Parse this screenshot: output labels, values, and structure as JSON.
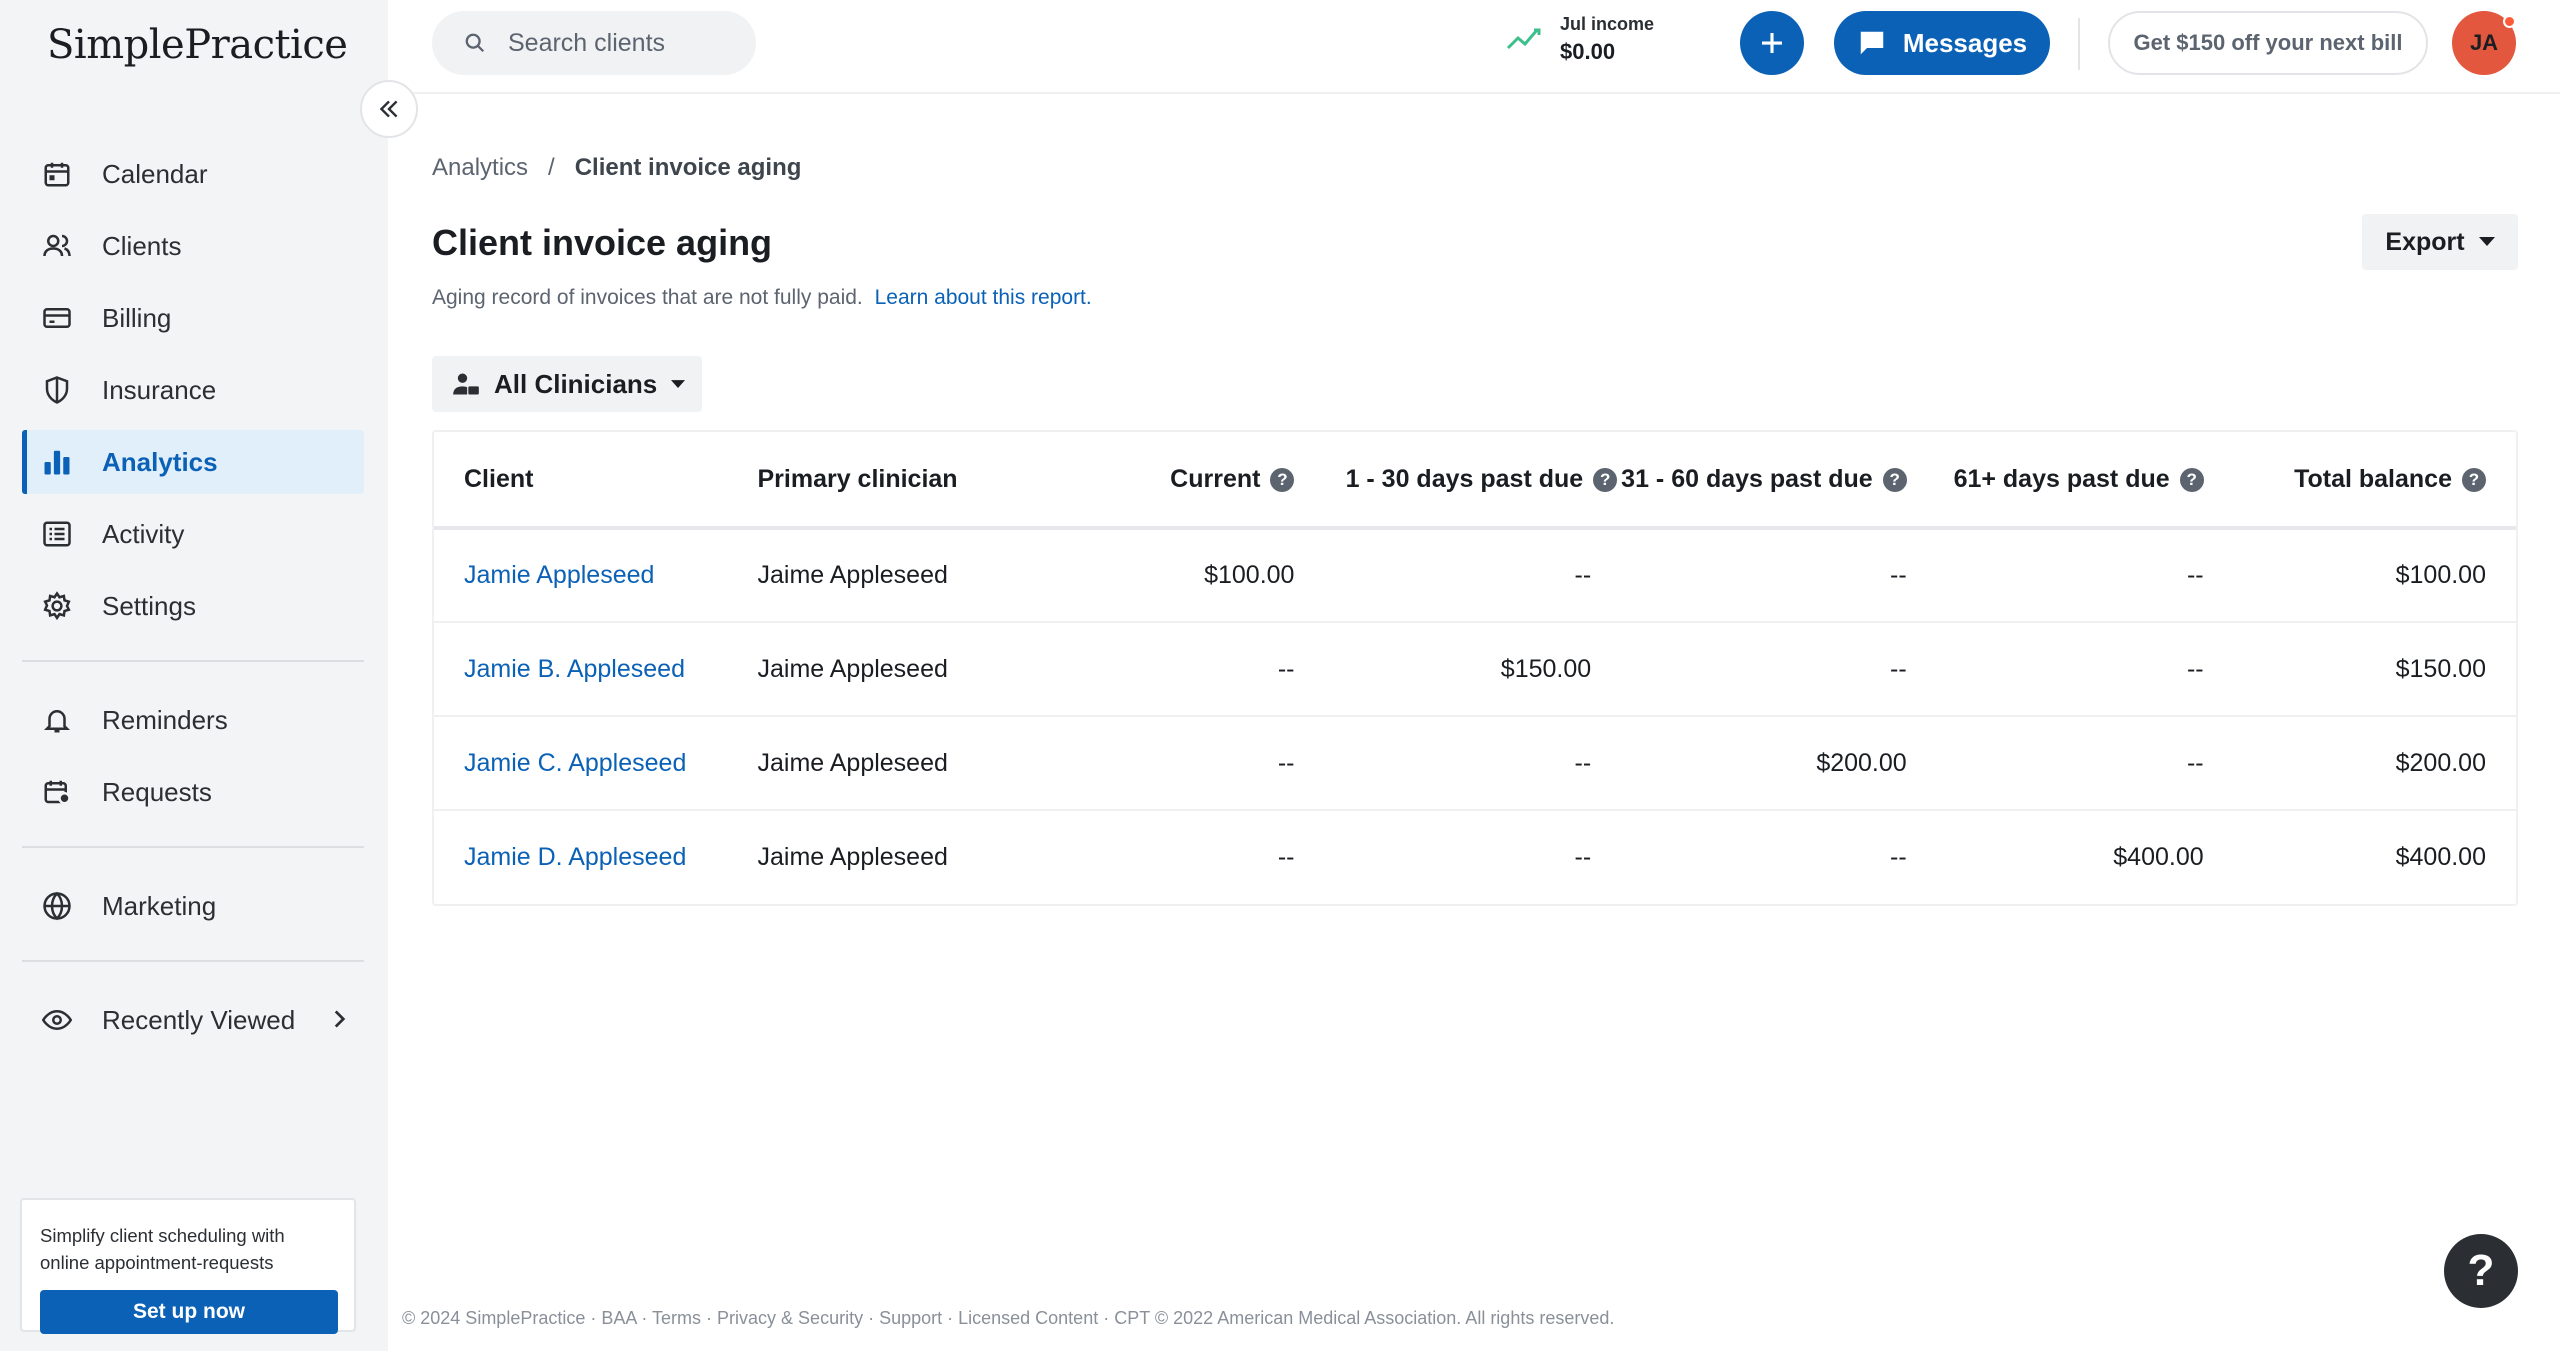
{
  "app": {
    "logo": "SimplePractice"
  },
  "sidebar": {
    "items": [
      {
        "label": "Calendar",
        "icon": "calendar-icon"
      },
      {
        "label": "Clients",
        "icon": "clients-icon"
      },
      {
        "label": "Billing",
        "icon": "billing-card-icon"
      },
      {
        "label": "Insurance",
        "icon": "shield-icon"
      },
      {
        "label": "Analytics",
        "icon": "bar-chart-icon",
        "active": true
      },
      {
        "label": "Activity",
        "icon": "activity-list-icon"
      },
      {
        "label": "Settings",
        "icon": "gear-icon"
      },
      {
        "label": "Reminders",
        "icon": "bell-icon"
      },
      {
        "label": "Requests",
        "icon": "calendar-request-icon"
      },
      {
        "label": "Marketing",
        "icon": "globe-icon"
      },
      {
        "label": "Recently Viewed",
        "icon": "eye-icon"
      }
    ],
    "promo": {
      "text": "Simplify client scheduling with online appointment-requests",
      "button": "Set up now"
    }
  },
  "topbar": {
    "search_placeholder": "Search clients",
    "income_label": "Jul income",
    "income_value": "$0.00",
    "messages_label": "Messages",
    "offer_label": "Get $150 off your next bill",
    "avatar_initials": "JA"
  },
  "breadcrumb": {
    "parent": "Analytics",
    "separator": "/",
    "current": "Client invoice aging"
  },
  "page": {
    "title": "Client invoice aging",
    "subtitle": "Aging record of invoices that are not fully paid.",
    "subtitle_link": "Learn about this report.",
    "export_label": "Export",
    "clinician_filter": "All Clinicians"
  },
  "table": {
    "headers": [
      "Client",
      "Primary clinician",
      "Current",
      "1 - 30 days past due",
      "31 - 60 days past due",
      "61+ days past due",
      "Total balance"
    ],
    "rows": [
      [
        "Jamie Appleseed",
        "Jaime Appleseed",
        "$100.00",
        "--",
        "--",
        "--",
        "$100.00"
      ],
      [
        "Jamie B. Appleseed",
        "Jaime Appleseed",
        "--",
        "$150.00",
        "--",
        "--",
        "$150.00"
      ],
      [
        "Jamie C. Appleseed",
        "Jaime Appleseed",
        "--",
        "--",
        "$200.00",
        "--",
        "$200.00"
      ],
      [
        "Jamie D. Appleseed",
        "Jaime Appleseed",
        "--",
        "--",
        "--",
        "$400.00",
        "$400.00"
      ]
    ]
  },
  "footer": {
    "text": "© 2024 SimplePractice · BAA · Terms · Privacy & Security · Support · Licensed Content · CPT © 2022 American Medical Association. All rights reserved.",
    "help_label": "?"
  },
  "colors": {
    "accent": "#0b61b6",
    "active_bg": "#e1effb",
    "avatar": "#e2573d",
    "income_trend": "#3dbf8c"
  }
}
